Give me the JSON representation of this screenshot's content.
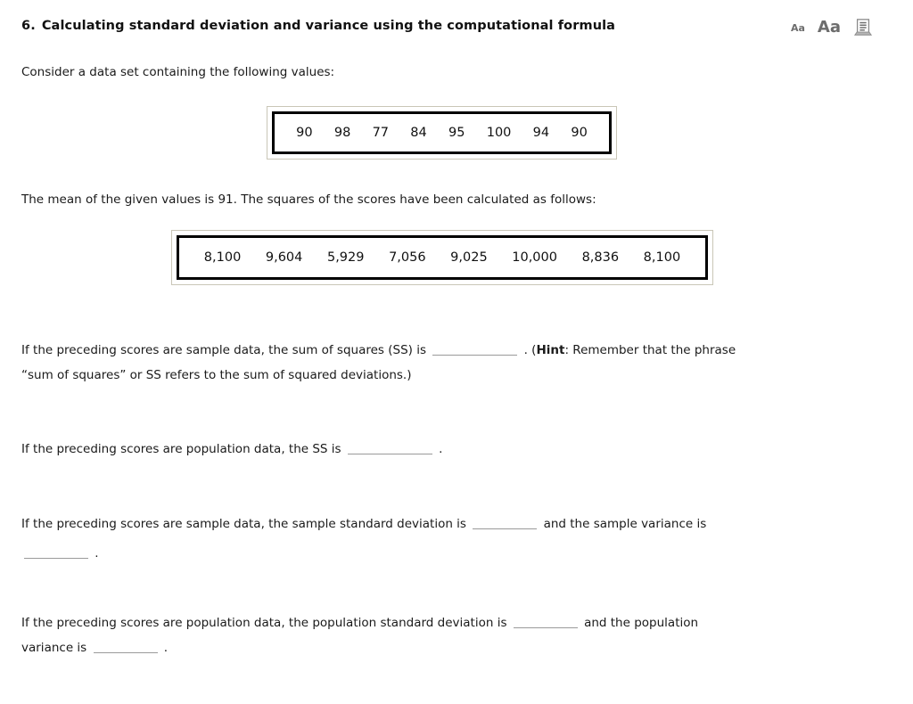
{
  "header": {
    "question_number": "6.",
    "title": "Calculating standard deviation and variance using the computational formula",
    "icons": {
      "decrease_font_label": "Aa",
      "increase_font_label": "Aa",
      "reader_icon_name": "document-reader-icon"
    }
  },
  "intro": {
    "line1": "Consider a data set containing the following values:",
    "line2": "The mean of the given values is 91. The squares of the scores have been calculated as follows:"
  },
  "values_box": {
    "cells": [
      "90",
      "98",
      "77",
      "84",
      "95",
      "100",
      "94",
      "90"
    ]
  },
  "squares_box": {
    "cells": [
      "8,100",
      "9,604",
      "5,929",
      "7,056",
      "9,025",
      "10,000",
      "8,836",
      "8,100"
    ]
  },
  "questions": {
    "q1": {
      "part1": "If the preceding scores are sample data, the sum of squares (SS) is",
      "blank_value": "",
      "part2": ". (",
      "hint_label": "Hint",
      "part3": ": Remember that the phrase",
      "line2": "“sum of squares” or SS refers to the sum of squared deviations.)"
    },
    "q2": {
      "part1": "If the preceding scores are population data, the SS is",
      "blank_value": "",
      "part2": "."
    },
    "q3": {
      "part1": "If the preceding scores are sample data, the sample standard deviation is",
      "blank1_value": "",
      "part2": "and the sample variance is",
      "blank2_value": "",
      "part3": "."
    },
    "q4": {
      "part1": "If the preceding scores are population data, the population standard deviation is",
      "blank1_value": "",
      "part2": "and the population",
      "line2_part1": "variance is",
      "blank2_value": "",
      "line2_part2": "."
    }
  },
  "colors": {
    "box_outer_border": "#c9c6b7",
    "box_inner_border": "#000000",
    "blank_underline": "#9a9a9a",
    "icon_gray": "#6d6d6d",
    "text": "#1a1a1a"
  }
}
